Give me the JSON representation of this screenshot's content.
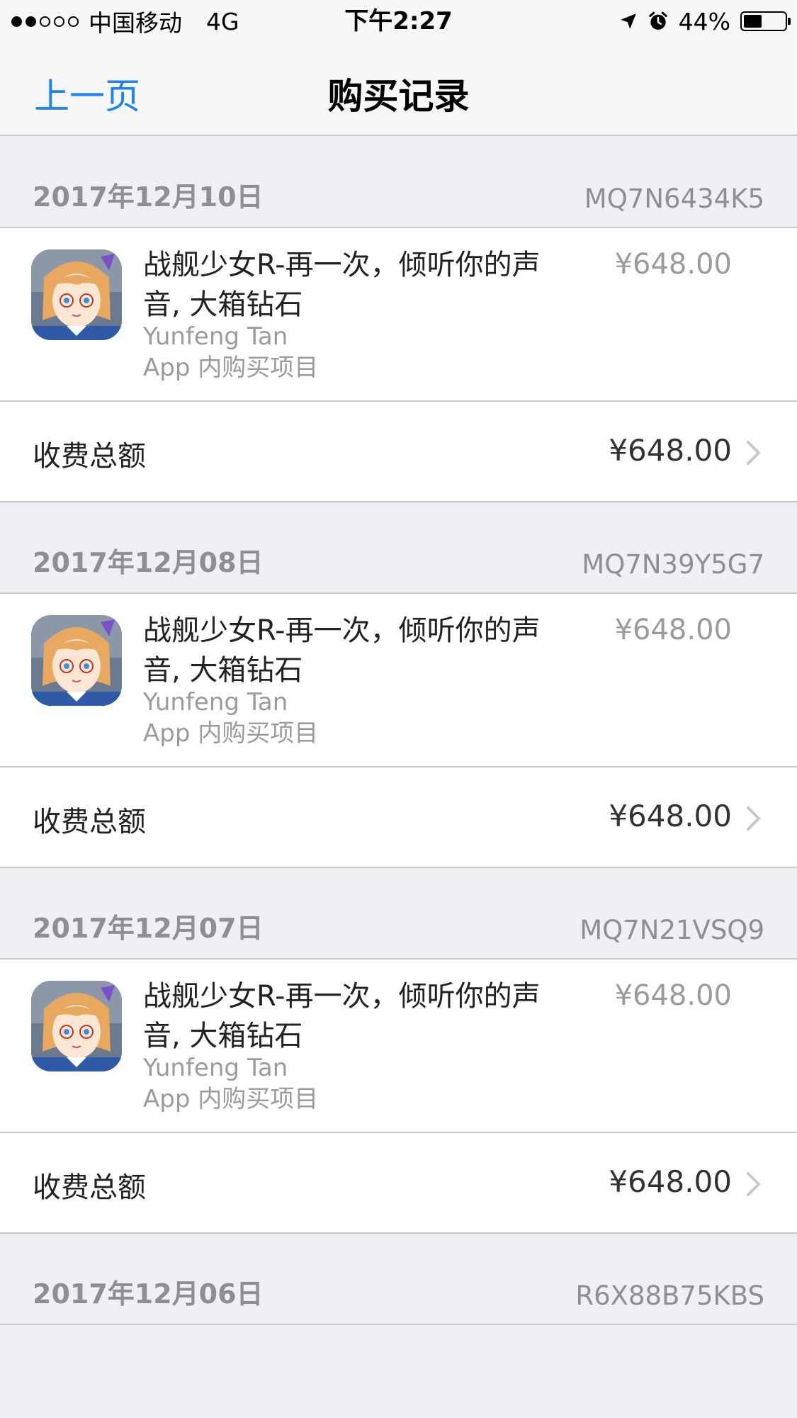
{
  "status_bar": {
    "carrier": "中国移动",
    "network": "4G",
    "time": "下午2:27",
    "battery_percent": "44%",
    "battery_level": 0.44,
    "icons": [
      "signal-dots-icon",
      "location-arrow-icon",
      "alarm-icon",
      "battery-icon"
    ]
  },
  "nav": {
    "back_label": "上一页",
    "title": "购买记录"
  },
  "colors": {
    "accent": "#1a82fb",
    "background": "#efeff4",
    "secondary_text": "#8e8e93"
  },
  "purchases": [
    {
      "date": "2017年12月10日",
      "order_id": "MQ7N6434K5",
      "item_title": "战舰少女R-再一次，倾听你的声音, 大箱钻石",
      "developer": "Yunfeng Tan",
      "item_type": "App 内购买项目",
      "item_price": "¥648.00",
      "total_label": "收费总额",
      "total_price": "¥648.00"
    },
    {
      "date": "2017年12月08日",
      "order_id": "MQ7N39Y5G7",
      "item_title": "战舰少女R-再一次，倾听你的声音, 大箱钻石",
      "developer": "Yunfeng Tan",
      "item_type": "App 内购买项目",
      "item_price": "¥648.00",
      "total_label": "收费总额",
      "total_price": "¥648.00"
    },
    {
      "date": "2017年12月07日",
      "order_id": "MQ7N21VSQ9",
      "item_title": "战舰少女R-再一次，倾听你的声音, 大箱钻石",
      "developer": "Yunfeng Tan",
      "item_type": "App 内购买项目",
      "item_price": "¥648.00",
      "total_label": "收费总额",
      "total_price": "¥648.00"
    },
    {
      "date": "2017年12月06日",
      "order_id": "R6X88B75KBS"
    }
  ]
}
